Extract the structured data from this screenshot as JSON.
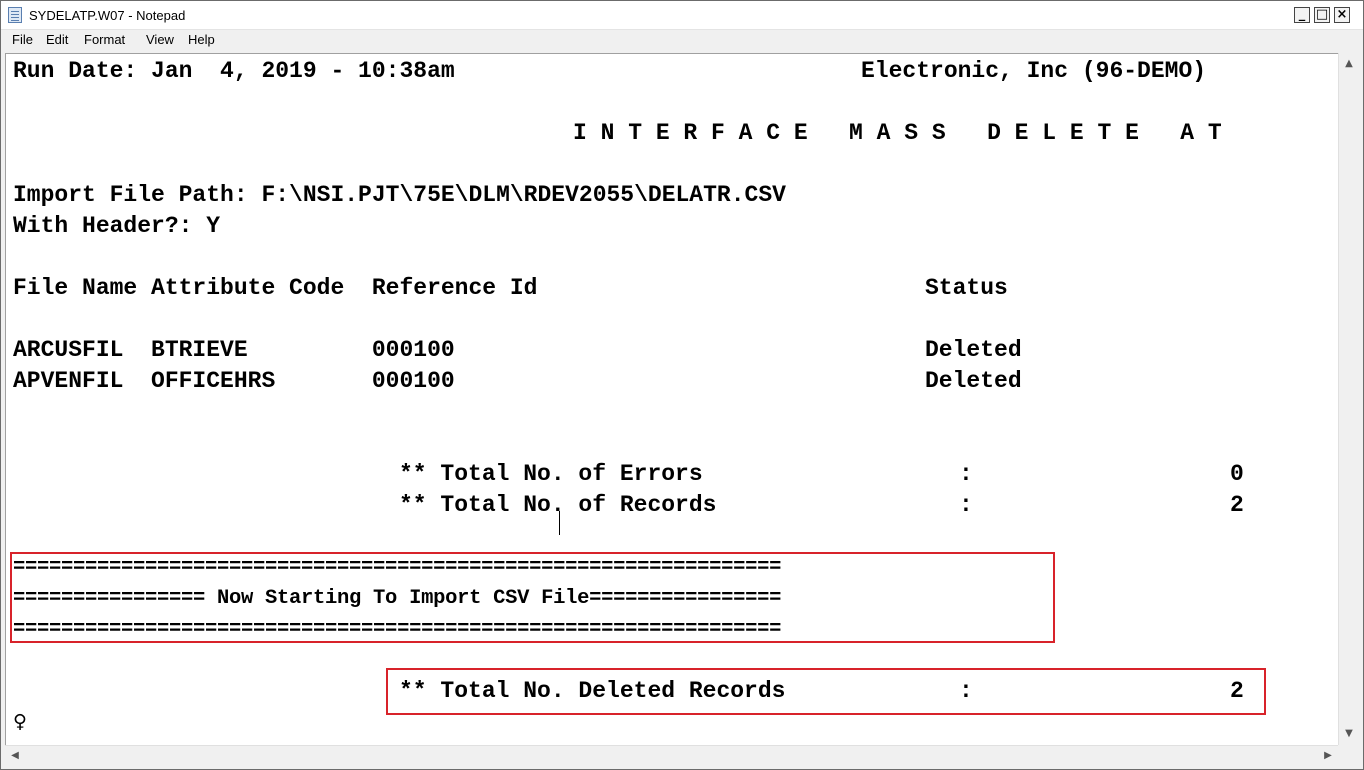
{
  "window": {
    "title": "SYDELATP.W07 - Notepad",
    "controls": {
      "minimize": "_",
      "maximize": "□",
      "close": "×"
    }
  },
  "menu": [
    "File",
    "Edit",
    "Format",
    "View",
    "Help"
  ],
  "document": {
    "header_left": "Run Date: Jan  4, 2019 - 10:38am",
    "header_right": "Electronic, Inc (96-DEMO)",
    "report_title": "I N T E R F A C E   M A S S   D E L E T E   A T",
    "import_path": "Import File Path: F:\\NSI.PJT\\75E\\DLM\\RDEV2055\\DELATR.CSV",
    "with_header": "With Header?: Y",
    "columns_line": "File Name Attribute Code  Reference Id",
    "status_header": "Status",
    "rows": [
      {
        "line": "ARCUSFIL  BTRIEVE         000100",
        "status": "Deleted"
      },
      {
        "line": "APVENFIL  OFFICEHRS       000100",
        "status": "Deleted"
      }
    ],
    "totals": [
      {
        "label": "** Total No. of Errors",
        "colon": ":",
        "value": "0"
      },
      {
        "label": "** Total No. of Records",
        "colon": ":",
        "value": "2"
      }
    ],
    "banner": [
      "================================================================",
      "================ Now Starting To Import CSV File================",
      "================================================================"
    ],
    "deleted_total": {
      "label": "** Total No. Deleted Records",
      "colon": ":",
      "value": "2"
    },
    "eof_marker": "♀"
  },
  "scrollbars": {
    "up": "▲",
    "down": "▼",
    "left": "◀",
    "right": "▶"
  }
}
